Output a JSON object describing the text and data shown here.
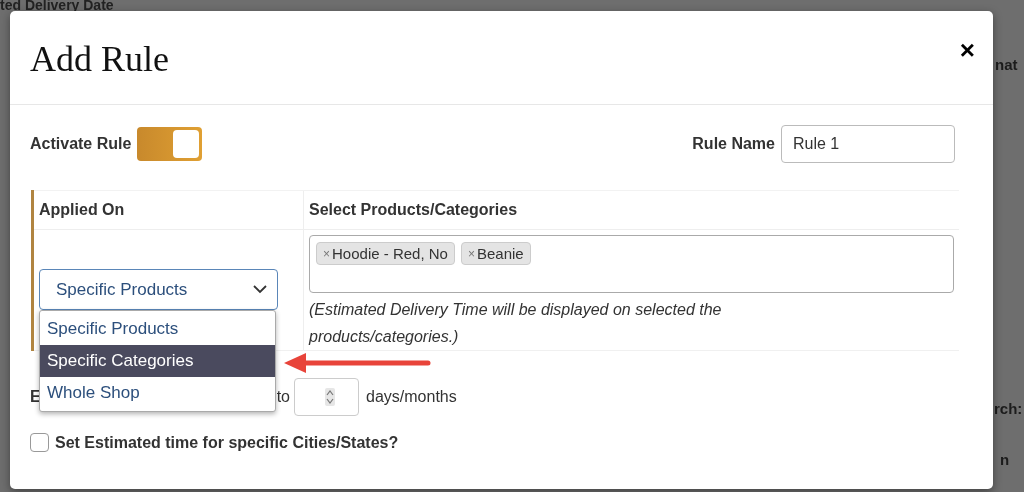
{
  "background_page": {
    "heading": "ted Delivery Date",
    "right_fragments": [
      "nat",
      "rch:",
      "n"
    ]
  },
  "modal": {
    "title": "Add Rule",
    "close": "×",
    "activate": {
      "label": "Activate Rule",
      "on": true
    },
    "rule_name": {
      "label": "Rule Name",
      "value": "Rule 1"
    },
    "table": {
      "columns": [
        "Applied On",
        "Select Products/Categories"
      ],
      "applied_on": {
        "value": "Specific Products",
        "expanded": true,
        "options": [
          {
            "label": "Specific Products",
            "highlighted": false
          },
          {
            "label": "Specific Categories",
            "highlighted": true
          },
          {
            "label": "Whole Shop",
            "highlighted": false
          }
        ]
      },
      "tags": [
        {
          "remove": "×",
          "label": "Hoodie - Red, No"
        },
        {
          "remove": "×",
          "label": "Beanie"
        }
      ],
      "note": "(Estimated Delivery Time will be displayed on selected the products/categories.)"
    },
    "estimate_row": {
      "label": "E",
      "to": "to",
      "unit": "days/months"
    },
    "cities": {
      "label": "Set Estimated time for specific Cities/States?",
      "checked": false
    }
  }
}
